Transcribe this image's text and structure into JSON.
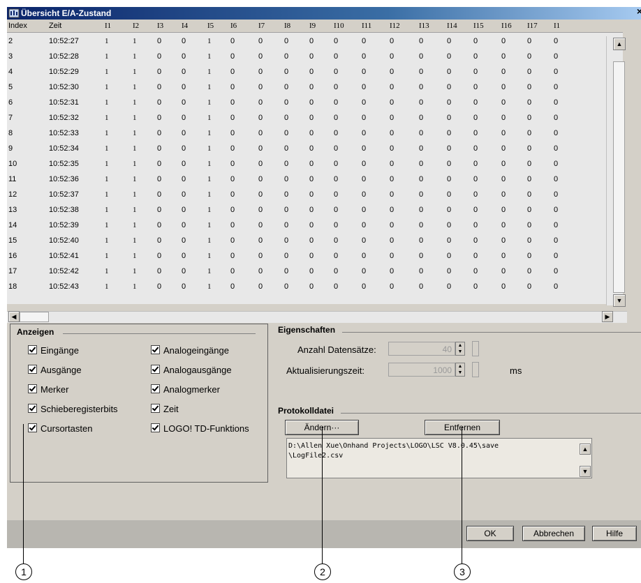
{
  "window": {
    "title": "Übersicht E/A-Zustand",
    "close_glyph": "×"
  },
  "table": {
    "columns": [
      "Index",
      "Zeit",
      "I1",
      "I2",
      "I3",
      "I4",
      "I5",
      "I6",
      "I7",
      "I8",
      "I9",
      "I10",
      "I11",
      "I12",
      "I13",
      "I14",
      "I15",
      "I16",
      "I17",
      "I1"
    ],
    "rows": [
      [
        "2",
        "10:52:27",
        "1",
        "1",
        "0",
        "0",
        "1",
        "0",
        "0",
        "0",
        "0",
        "0",
        "0",
        "0",
        "0",
        "0",
        "0",
        "0",
        "0",
        "0"
      ],
      [
        "3",
        "10:52:28",
        "1",
        "1",
        "0",
        "0",
        "1",
        "0",
        "0",
        "0",
        "0",
        "0",
        "0",
        "0",
        "0",
        "0",
        "0",
        "0",
        "0",
        "0"
      ],
      [
        "4",
        "10:52:29",
        "1",
        "1",
        "0",
        "0",
        "1",
        "0",
        "0",
        "0",
        "0",
        "0",
        "0",
        "0",
        "0",
        "0",
        "0",
        "0",
        "0",
        "0"
      ],
      [
        "5",
        "10:52:30",
        "1",
        "1",
        "0",
        "0",
        "1",
        "0",
        "0",
        "0",
        "0",
        "0",
        "0",
        "0",
        "0",
        "0",
        "0",
        "0",
        "0",
        "0"
      ],
      [
        "6",
        "10:52:31",
        "1",
        "1",
        "0",
        "0",
        "1",
        "0",
        "0",
        "0",
        "0",
        "0",
        "0",
        "0",
        "0",
        "0",
        "0",
        "0",
        "0",
        "0"
      ],
      [
        "7",
        "10:52:32",
        "1",
        "1",
        "0",
        "0",
        "1",
        "0",
        "0",
        "0",
        "0",
        "0",
        "0",
        "0",
        "0",
        "0",
        "0",
        "0",
        "0",
        "0"
      ],
      [
        "8",
        "10:52:33",
        "1",
        "1",
        "0",
        "0",
        "1",
        "0",
        "0",
        "0",
        "0",
        "0",
        "0",
        "0",
        "0",
        "0",
        "0",
        "0",
        "0",
        "0"
      ],
      [
        "9",
        "10:52:34",
        "1",
        "1",
        "0",
        "0",
        "1",
        "0",
        "0",
        "0",
        "0",
        "0",
        "0",
        "0",
        "0",
        "0",
        "0",
        "0",
        "0",
        "0"
      ],
      [
        "10",
        "10:52:35",
        "1",
        "1",
        "0",
        "0",
        "1",
        "0",
        "0",
        "0",
        "0",
        "0",
        "0",
        "0",
        "0",
        "0",
        "0",
        "0",
        "0",
        "0"
      ],
      [
        "11",
        "10:52:36",
        "1",
        "1",
        "0",
        "0",
        "1",
        "0",
        "0",
        "0",
        "0",
        "0",
        "0",
        "0",
        "0",
        "0",
        "0",
        "0",
        "0",
        "0"
      ],
      [
        "12",
        "10:52:37",
        "1",
        "1",
        "0",
        "0",
        "1",
        "0",
        "0",
        "0",
        "0",
        "0",
        "0",
        "0",
        "0",
        "0",
        "0",
        "0",
        "0",
        "0"
      ],
      [
        "13",
        "10:52:38",
        "1",
        "1",
        "0",
        "0",
        "1",
        "0",
        "0",
        "0",
        "0",
        "0",
        "0",
        "0",
        "0",
        "0",
        "0",
        "0",
        "0",
        "0"
      ],
      [
        "14",
        "10:52:39",
        "1",
        "1",
        "0",
        "0",
        "1",
        "0",
        "0",
        "0",
        "0",
        "0",
        "0",
        "0",
        "0",
        "0",
        "0",
        "0",
        "0",
        "0"
      ],
      [
        "15",
        "10:52:40",
        "1",
        "1",
        "0",
        "0",
        "1",
        "0",
        "0",
        "0",
        "0",
        "0",
        "0",
        "0",
        "0",
        "0",
        "0",
        "0",
        "0",
        "0"
      ],
      [
        "16",
        "10:52:41",
        "1",
        "1",
        "0",
        "0",
        "1",
        "0",
        "0",
        "0",
        "0",
        "0",
        "0",
        "0",
        "0",
        "0",
        "0",
        "0",
        "0",
        "0"
      ],
      [
        "17",
        "10:52:42",
        "1",
        "1",
        "0",
        "0",
        "1",
        "0",
        "0",
        "0",
        "0",
        "0",
        "0",
        "0",
        "0",
        "0",
        "0",
        "0",
        "0",
        "0"
      ],
      [
        "18",
        "10:52:43",
        "1",
        "1",
        "0",
        "0",
        "1",
        "0",
        "0",
        "0",
        "0",
        "0",
        "0",
        "0",
        "0",
        "0",
        "0",
        "0",
        "0",
        "0"
      ]
    ]
  },
  "anzeigen": {
    "title": "Anzeigen",
    "left": [
      "Eingänge",
      "Ausgänge",
      "Merker",
      "Schieberegisterbits",
      "Cursortasten"
    ],
    "right": [
      "Analogeingänge",
      "Analogausgänge",
      "Analogmerker",
      "Zeit",
      "LOGO! TD-Funktions"
    ]
  },
  "eigenschaften": {
    "title": "Eigenschaften",
    "datensaetze_label": "Anzahl Datensätze:",
    "datensaetze_value": "40",
    "aktualisierung_label": "Aktualisierungszeit:",
    "aktualisierung_value": "1000",
    "unit": "ms"
  },
  "protokoll": {
    "title": "Protokolldatei",
    "aendern": "Ändern···",
    "entfernen": "Entfernen",
    "path_line1": "D:\\Allen Xue\\Onhand Projects\\LOGO\\LSC V8.0.45\\save",
    "path_line2": "\\LogFile2.csv"
  },
  "buttons": {
    "ok": "OK",
    "abbrechen": "Abbrechen",
    "hilfe": "Hilfe"
  },
  "callouts": [
    "1",
    "2",
    "3"
  ]
}
